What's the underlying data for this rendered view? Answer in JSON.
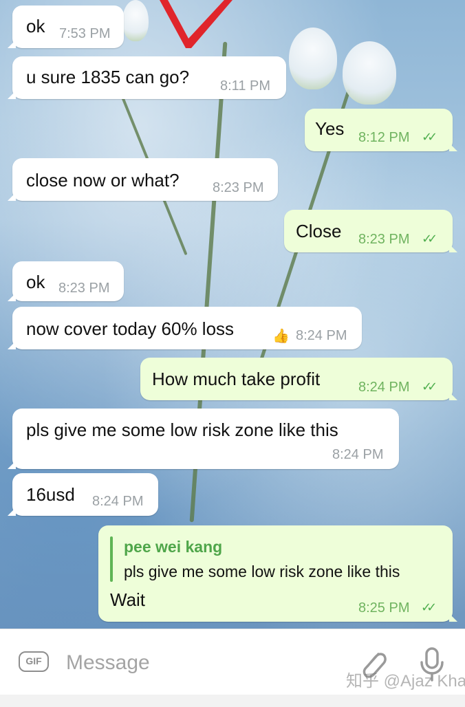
{
  "messages": [
    {
      "dir": "in",
      "text": "ok",
      "time": "7:53 PM"
    },
    {
      "dir": "in",
      "text": "u sure 1835 can go?",
      "time": "8:11 PM"
    },
    {
      "dir": "out",
      "text": "Yes",
      "time": "8:12 PM",
      "ticks": "✓✓"
    },
    {
      "dir": "in",
      "text": "close now or what?",
      "time": "8:23 PM"
    },
    {
      "dir": "out",
      "text": "Close",
      "time": "8:23 PM",
      "ticks": "✓✓"
    },
    {
      "dir": "in",
      "text": "ok",
      "time": "8:23 PM"
    },
    {
      "dir": "in",
      "text": "now cover today 60% loss",
      "time": "8:24 PM",
      "emoji": "👍"
    },
    {
      "dir": "out",
      "text": "How much take profit",
      "time": "8:24 PM",
      "ticks": "✓✓"
    },
    {
      "dir": "in",
      "text": "pls give me some low risk zone like this",
      "time": "8:24 PM"
    },
    {
      "dir": "in",
      "text": "16usd",
      "time": "8:24 PM"
    },
    {
      "dir": "out",
      "text": "Wait",
      "time": "8:25 PM",
      "ticks": "✓✓",
      "reply": {
        "name": "pee wei kang",
        "text": "pls give me some low risk zone like this"
      }
    }
  ],
  "input": {
    "gif_label": "GIF",
    "placeholder": "Message",
    "icons": [
      "gif-icon",
      "paperclip-icon",
      "microphone-icon"
    ]
  },
  "watermark": "知乎 @Ajaz Khan",
  "colors": {
    "incoming_bubble": "#ffffff",
    "outgoing_bubble": "#eefed9",
    "time_outgoing": "#6fb35f",
    "quote_accent": "#5fb555"
  }
}
